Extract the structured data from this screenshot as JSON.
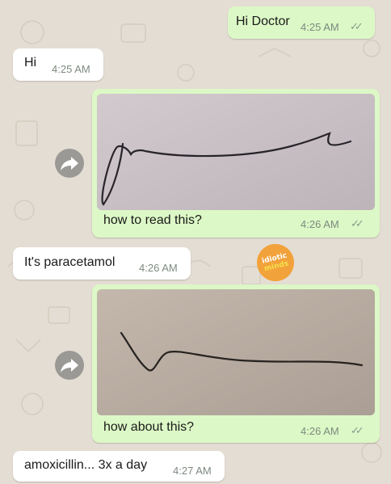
{
  "colors": {
    "outgoing_bubble": "#dcf8c6",
    "incoming_bubble": "#ffffff",
    "chat_background": "#e4ddd3",
    "timestamp": "#7d8a80"
  },
  "messages": [
    {
      "direction": "outgoing",
      "text": "Hi Doctor",
      "time": "4:25 AM",
      "status_icon": "double-check-icon"
    },
    {
      "direction": "incoming",
      "text": "Hi",
      "time": "4:25 AM"
    },
    {
      "direction": "outgoing",
      "type": "image",
      "caption": "how to read this?",
      "time": "4:26 AM",
      "status_icon": "double-check-icon"
    },
    {
      "direction": "incoming",
      "text": "It's paracetamol",
      "time": "4:26 AM"
    },
    {
      "direction": "outgoing",
      "type": "image",
      "caption": "how about this?",
      "time": "4:26 AM",
      "status_icon": "double-check-icon"
    },
    {
      "direction": "incoming",
      "text": "amoxicillin... 3x a day",
      "time": "4:27 AM"
    }
  ],
  "watermark": {
    "line1": "idiotic",
    "line2": "minds"
  }
}
